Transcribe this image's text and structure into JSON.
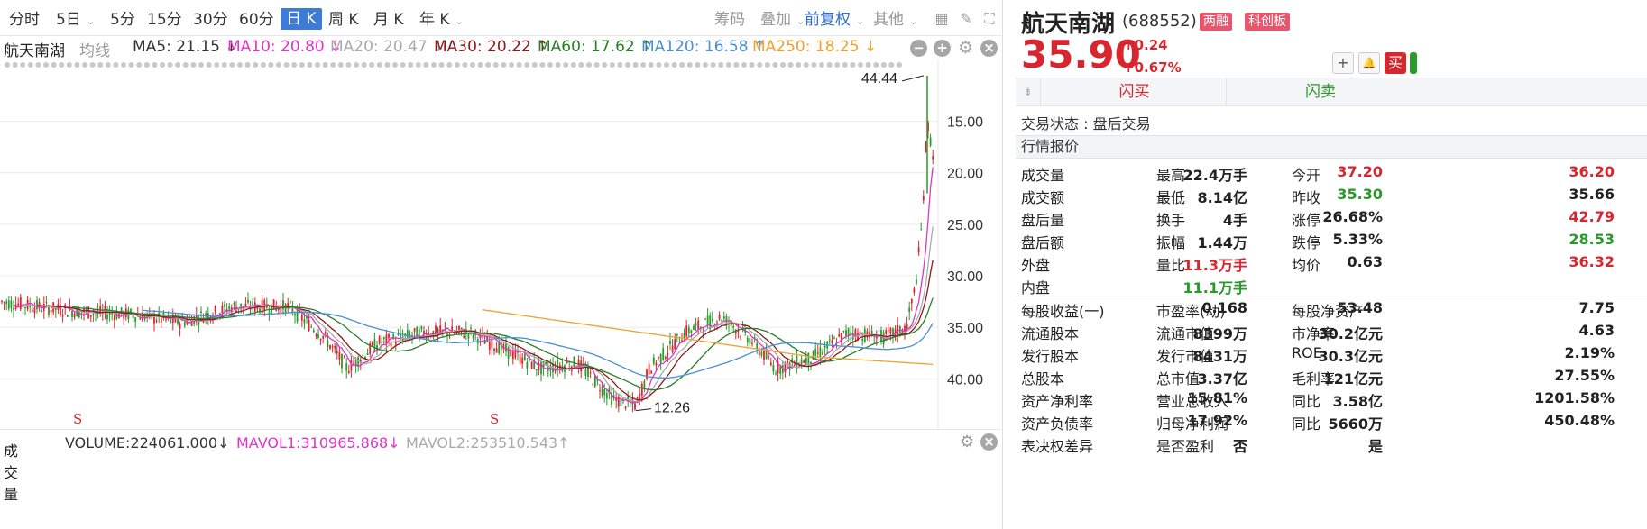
{
  "toolbar": {
    "periods": [
      "分时",
      "5日",
      "5分",
      "15分",
      "30分",
      "60分",
      "日 K",
      "周 K",
      "月 K",
      "年 K"
    ],
    "right": [
      "筹码",
      "叠加",
      "前复权",
      "其他"
    ]
  },
  "ma_row": {
    "stock": "航天南湖",
    "type": "均线",
    "items": [
      {
        "label": "MA5: 21.15 ↓",
        "color": "#333333"
      },
      {
        "label": "MA10: 20.80 ↓",
        "color": "#e033c8"
      },
      {
        "label": "MA20: 20.47 ↓",
        "color": "#aaaaaa"
      },
      {
        "label": "MA30: 20.22 ↑",
        "color": "#8b1a1a"
      },
      {
        "label": "MA60: 17.62 ↑",
        "color": "#2a7d2a"
      },
      {
        "label": "MA120: 16.58 ↑",
        "color": "#4a8fd4"
      },
      {
        "label": "MA250: 18.25 ↓",
        "color": "#f0a030"
      }
    ]
  },
  "chart": {
    "y_ticks": [
      "40.00",
      "35.00",
      "30.00",
      "25.00",
      "20.00",
      "15.00"
    ],
    "high_label": "44.44",
    "low_label": "12.26",
    "markers": [
      "S",
      "S"
    ]
  },
  "chart_data": {
    "type": "candlestick",
    "title": "",
    "ylim": [
      11,
      46
    ],
    "y_ticks": [
      15,
      20,
      25,
      30,
      35,
      40
    ],
    "high": 44.44,
    "low": 12.26,
    "ma_latest": {
      "MA5": 21.15,
      "MA10": 20.8,
      "MA20": 20.47,
      "MA30": 20.22,
      "MA60": 17.62,
      "MA120": 16.58,
      "MA250": 18.25
    }
  },
  "volume": {
    "label": "成交量",
    "vol": "VOLUME:224061.000↓",
    "mavol1": "MAVOL1:310965.868↓",
    "mavol2": "MAVOL2:253510.543↑"
  },
  "quote": {
    "name": "航天南湖",
    "code": "(688552)",
    "badges": [
      "两融",
      "科创板"
    ],
    "price": "35.90",
    "change": "↑0.24",
    "change_pct": "+0.67%",
    "buttons": {
      "plus": "+",
      "bell": "🔔",
      "buy": "买"
    },
    "flash_buy": "闪买",
    "flash_sell": "闪卖",
    "status": "交易状态 : 盘后交易",
    "section": "行情报价",
    "rows": [
      [
        [
          "成交量",
          "22.4万手",
          "n"
        ],
        [
          "最高",
          "37.20",
          "r"
        ],
        [
          "今开",
          "36.20",
          "r"
        ]
      ],
      [
        [
          "成交额",
          "8.14亿",
          "n"
        ],
        [
          "最低",
          "35.30",
          "g"
        ],
        [
          "昨收",
          "35.66",
          "n"
        ]
      ],
      [
        [
          "盘后量",
          "4手",
          "n"
        ],
        [
          "换手",
          "26.68%",
          "n"
        ],
        [
          "涨停",
          "42.79",
          "r"
        ]
      ],
      [
        [
          "盘后额",
          "1.44万",
          "n"
        ],
        [
          "振幅",
          "5.33%",
          "n"
        ],
        [
          "跌停",
          "28.53",
          "g"
        ]
      ],
      [
        [
          "外盘",
          "11.3万手",
          "r"
        ],
        [
          "量比",
          "0.63",
          "n"
        ],
        [
          "均价",
          "36.32",
          "r"
        ]
      ],
      [
        [
          "内盘",
          "11.1万手",
          "g"
        ]
      ]
    ],
    "rows2": [
      [
        [
          "每股收益(一)",
          "0.168",
          "n"
        ],
        [
          "市盈率(动)",
          "53.48",
          "n"
        ],
        [
          "每股净资产",
          "7.75",
          "n"
        ]
      ],
      [
        [
          "流通股本",
          "8399万",
          "n"
        ],
        [
          "流通市值",
          "30.2亿元",
          "n"
        ],
        [
          "市净率",
          "4.63",
          "n"
        ]
      ],
      [
        [
          "发行股本",
          "8431万",
          "n"
        ],
        [
          "发行市值",
          "30.3亿元",
          "n"
        ],
        [
          "ROE",
          "2.19%",
          "n"
        ]
      ],
      [
        [
          "总股本",
          "3.37亿",
          "n"
        ],
        [
          "总市值",
          "121亿元",
          "n"
        ],
        [
          "毛利率",
          "27.55%",
          "n"
        ]
      ],
      [
        [
          "资产净利率",
          "15.81%",
          "n"
        ],
        [
          "营业总收入",
          "3.58亿",
          "n"
        ],
        [
          "同比",
          "1201.58%",
          "n"
        ]
      ],
      [
        [
          "资产负债率",
          "17.92%",
          "n"
        ],
        [
          "归母净利润",
          "5660万",
          "n"
        ],
        [
          "同比",
          "450.48%",
          "n"
        ]
      ],
      [
        [
          "表决权差异",
          "否",
          "n"
        ],
        [
          "是否盈利",
          "是",
          "n"
        ]
      ]
    ]
  }
}
